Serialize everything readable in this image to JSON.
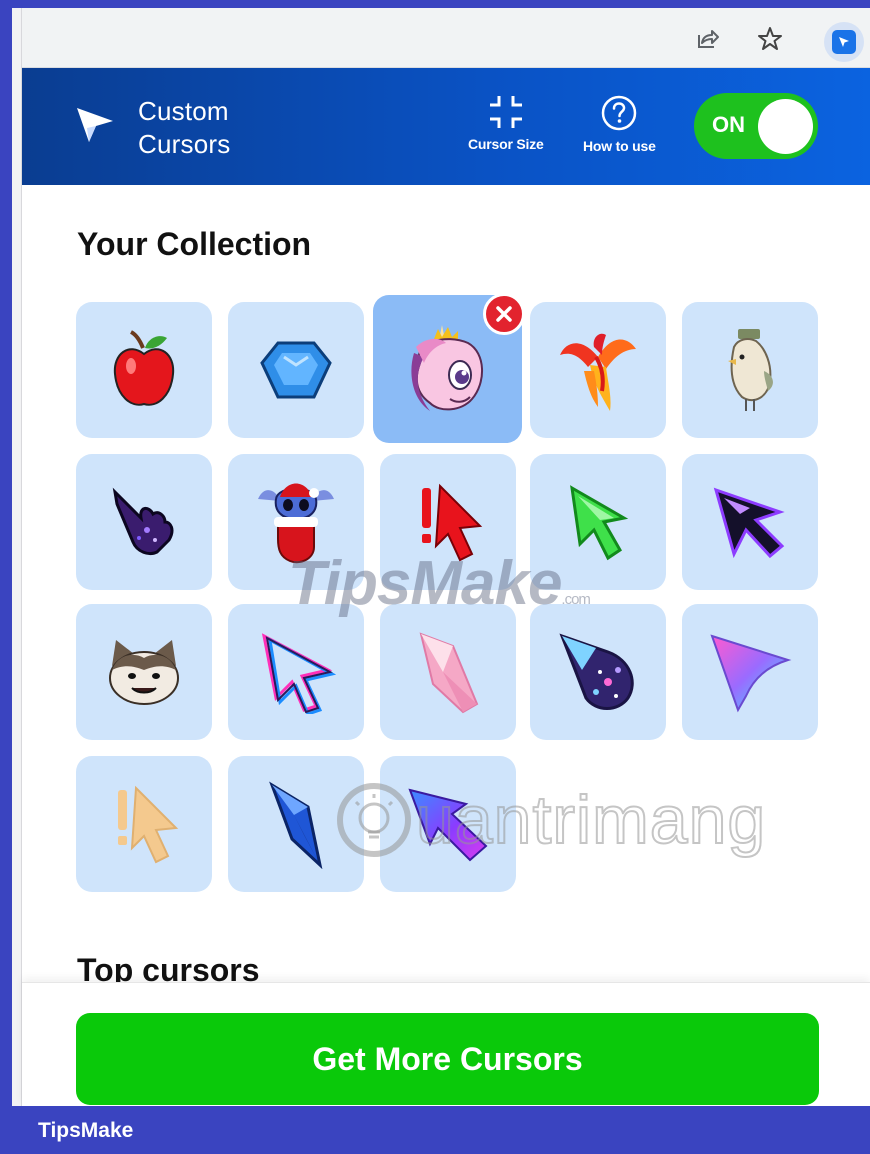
{
  "header": {
    "title_line1": "Custom",
    "title_line2": "Cursors",
    "cursor_size_label": "Cursor Size",
    "how_to_use_label": "How to use",
    "toggle_label": "ON"
  },
  "collection": {
    "title": "Your Collection",
    "items": [
      {
        "icon": "apple-cursor-icon"
      },
      {
        "icon": "blue-gem-cursor-icon"
      },
      {
        "icon": "pony-cursor-icon",
        "selected": true
      },
      {
        "icon": "phoenix-cursor-icon"
      },
      {
        "icon": "bird-cursor-icon"
      },
      {
        "icon": "galaxy-hand-cursor-icon"
      },
      {
        "icon": "stitch-stocking-cursor-icon"
      },
      {
        "icon": "red-alert-arrow-cursor-icon"
      },
      {
        "icon": "green-arrow-cursor-icon"
      },
      {
        "icon": "pixel-purple-arrow-cursor-icon"
      },
      {
        "icon": "popcat-cursor-icon"
      },
      {
        "icon": "neon-outline-arrow-cursor-icon"
      },
      {
        "icon": "pink-crystal-cursor-icon"
      },
      {
        "icon": "space-bubble-cursor-icon"
      },
      {
        "icon": "holographic-arrow-cursor-icon"
      },
      {
        "icon": "beige-alert-arrow-cursor-icon"
      },
      {
        "icon": "blue-crystal-cursor-icon"
      },
      {
        "icon": "purple-3d-arrow-cursor-icon"
      }
    ]
  },
  "top_cursors": {
    "title": "Top cursors"
  },
  "cta": {
    "label": "Get More Cursors"
  },
  "watermarks": {
    "tipsmake": "TipsMake",
    "tipsmake_suffix": ".com",
    "quantrimang": "uantrimang"
  },
  "brand_bar": {
    "label": "TipsMake"
  },
  "colors": {
    "header_start": "#0a3d91",
    "header_end": "#0b63e0",
    "toggle_on": "#1ec11e",
    "cta": "#0ac90a",
    "tile": "#cfe4fb",
    "tile_selected": "#8bbbf6",
    "remove": "#e2232e",
    "frame": "#3a44c0"
  }
}
